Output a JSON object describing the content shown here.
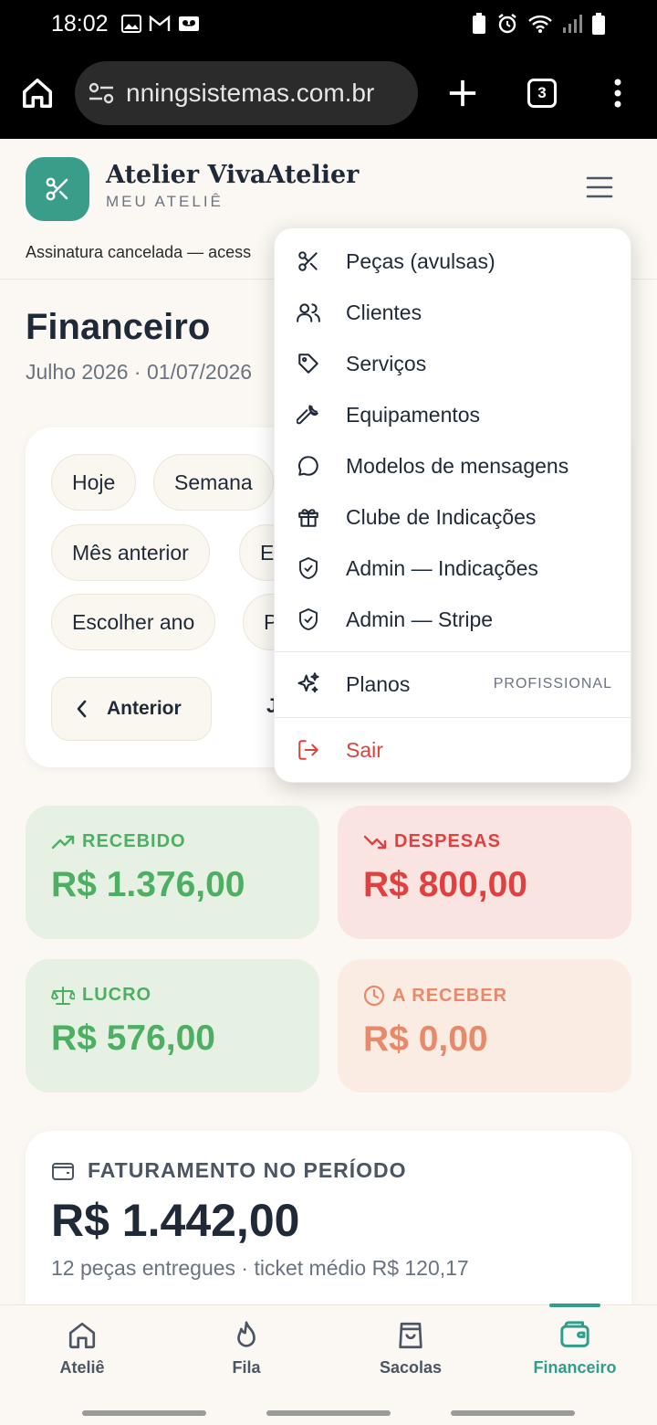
{
  "status_bar": {
    "time": "18:02"
  },
  "browser": {
    "url": "nningsistemas.com.br",
    "tab_count": "3"
  },
  "header": {
    "brand_name": "Atelier VivaAtelier",
    "brand_sub": "MEU ATELIÊ",
    "banner": "Assinatura cancelada — acess"
  },
  "page": {
    "title": "Financeiro",
    "subtitle": "Julho 2026 · 01/07/2026"
  },
  "filters": {
    "chips": [
      "Hoje",
      "Semana",
      "Mês anterior",
      "E",
      "Escolher ano",
      "P"
    ],
    "prev_label": "Anterior",
    "period_fragment": "J"
  },
  "stats": {
    "recebido": {
      "label": "RECEBIDO",
      "value": "R$ 1.376,00",
      "color": "#4caf63"
    },
    "despesas": {
      "label": "DESPESAS",
      "value": "R$ 800,00",
      "color": "#e04040"
    },
    "lucro": {
      "label": "LUCRO",
      "value": "R$ 576,00",
      "color": "#4caf63"
    },
    "a_receber": {
      "label": "A RECEBER",
      "value": "R$ 0,00",
      "color": "#e8896a"
    }
  },
  "faturamento": {
    "label": "FATURAMENTO NO PERÍODO",
    "value": "R$ 1.442,00",
    "desc": "12 peças entregues · ticket médio R$ 120,17"
  },
  "menu": {
    "items": [
      {
        "label": "Peças (avulsas)",
        "icon": "scissors-icon"
      },
      {
        "label": "Clientes",
        "icon": "users-icon"
      },
      {
        "label": "Serviços",
        "icon": "tag-icon"
      },
      {
        "label": "Equipamentos",
        "icon": "wrench-icon"
      },
      {
        "label": "Modelos de mensagens",
        "icon": "message-icon"
      },
      {
        "label": "Clube de Indicações",
        "icon": "gift-icon"
      },
      {
        "label": "Admin — Indicações",
        "icon": "shield-icon"
      },
      {
        "label": "Admin — Stripe",
        "icon": "shield-icon"
      }
    ],
    "plans": {
      "label": "Planos",
      "badge": "PROFISSIONAL",
      "icon": "sparkles-icon"
    },
    "logout": {
      "label": "Sair",
      "icon": "logout-icon"
    }
  },
  "bottom_nav": [
    {
      "label": "Ateliê",
      "icon": "home-icon"
    },
    {
      "label": "Fila",
      "icon": "flame-icon"
    },
    {
      "label": "Sacolas",
      "icon": "bag-icon"
    },
    {
      "label": "Financeiro",
      "icon": "wallet-icon",
      "active": true
    }
  ],
  "colors": {
    "accent": "#3a9d8a",
    "danger": "#d9443b"
  }
}
